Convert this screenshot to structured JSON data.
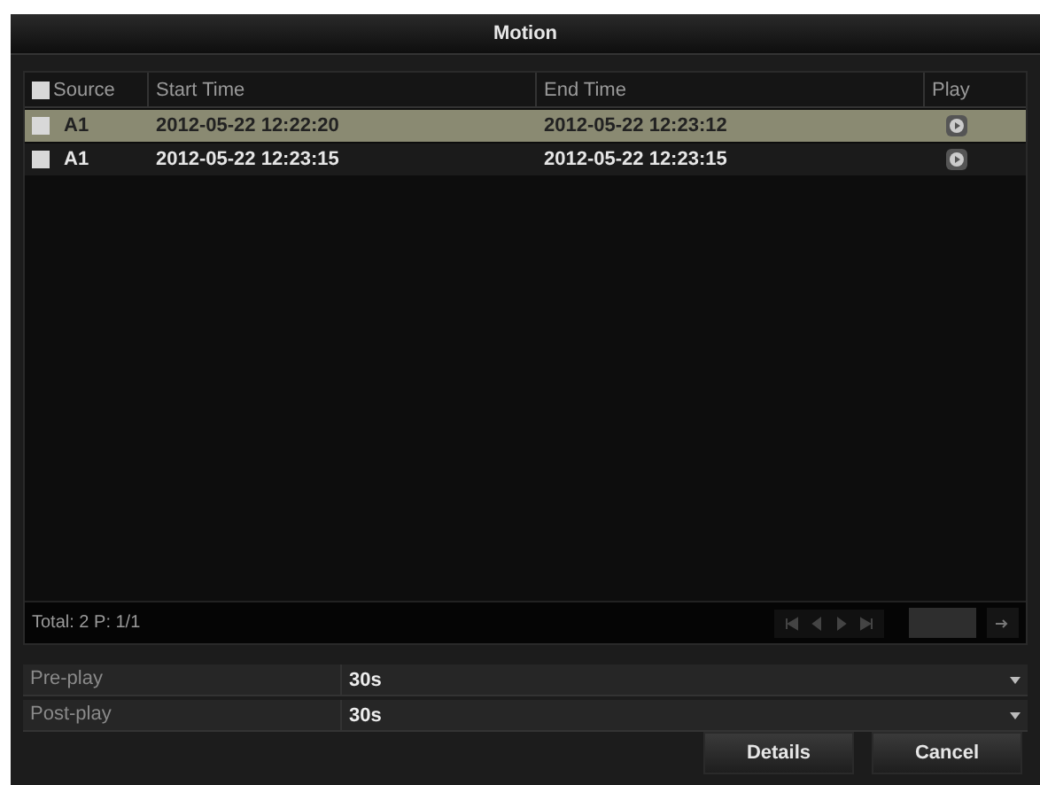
{
  "window": {
    "title": "Motion"
  },
  "table": {
    "select_all": {
      "checked": false
    },
    "columns": [
      "Source",
      "Start Time",
      "End Time",
      "Play"
    ],
    "rows": [
      {
        "source": "A1",
        "start": "2012-05-22 12:22:20",
        "end": "2012-05-22 12:23:12",
        "checked": false,
        "selected": true
      },
      {
        "source": "A1",
        "start": "2012-05-22 12:23:15",
        "end": "2012-05-22 12:23:15",
        "checked": false,
        "selected": false
      }
    ]
  },
  "pager": {
    "summary": "Total: 2  P: 1/1"
  },
  "fields": [
    {
      "label": "Pre-play",
      "value": "30s"
    },
    {
      "label": "Post-play",
      "value": "30s"
    }
  ],
  "buttons": [
    "Details",
    "Cancel"
  ]
}
